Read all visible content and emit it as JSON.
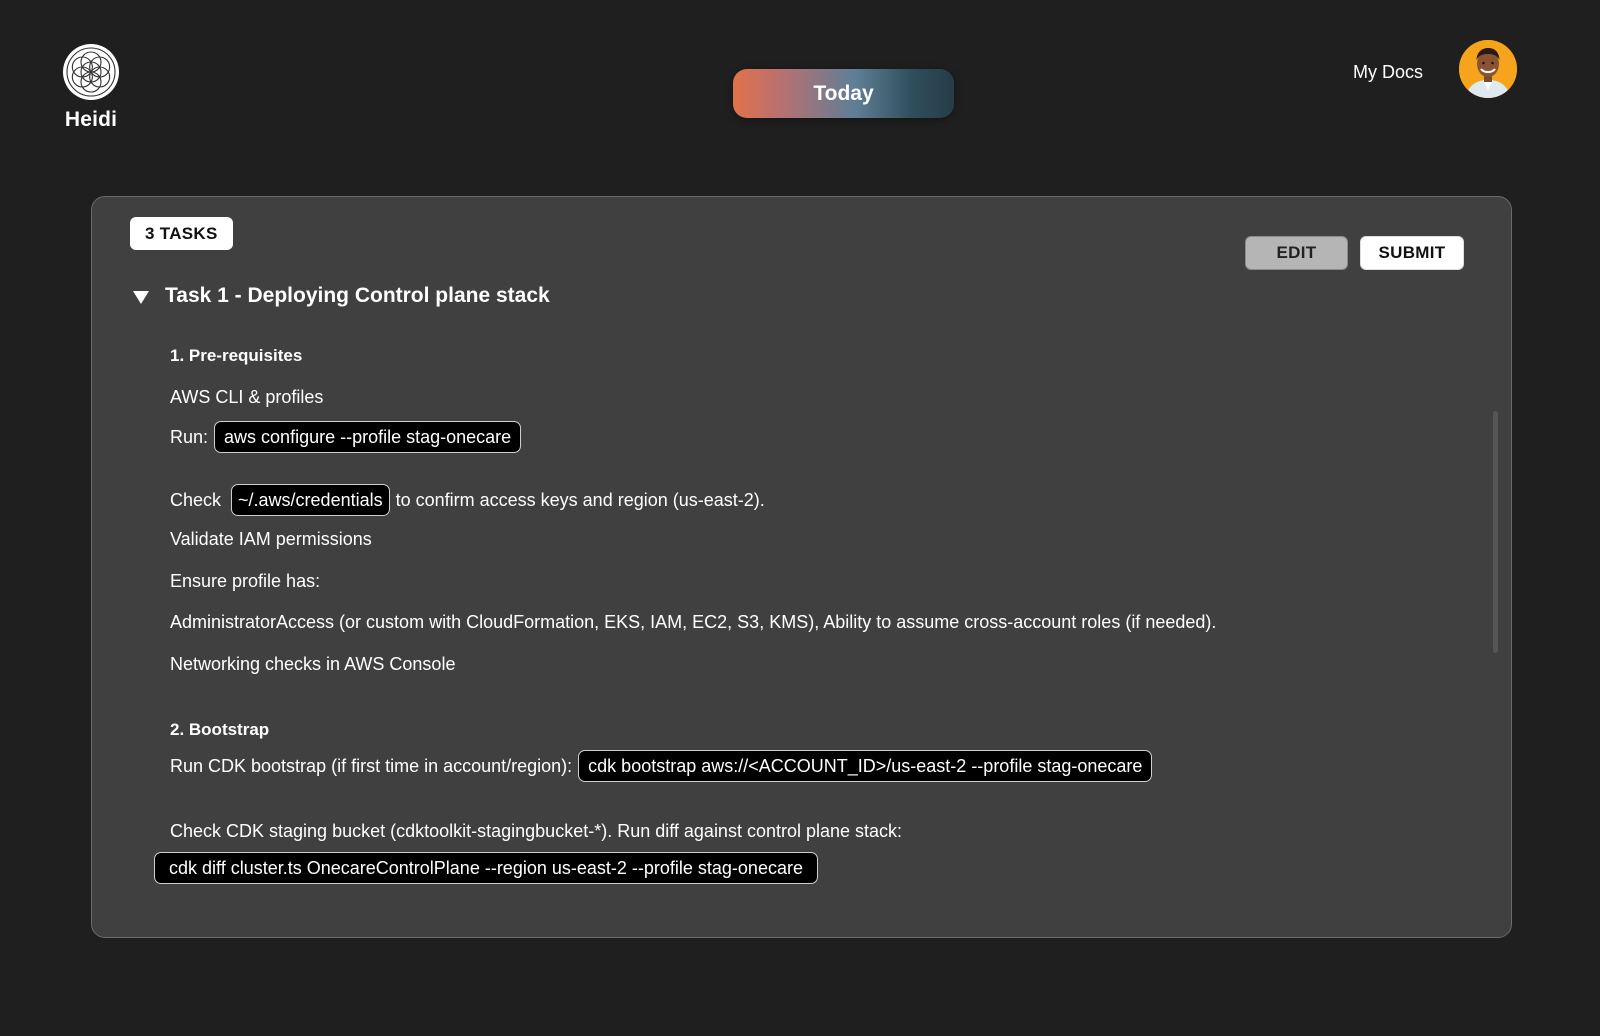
{
  "header": {
    "logo_text": "Heidi",
    "today_label": "Today",
    "my_docs_label": "My Docs"
  },
  "card": {
    "tasks_badge": "3 TASKS",
    "edit_label": "EDIT",
    "submit_label": "SUBMIT",
    "task_title": "Task 1 - Deploying Control plane stack",
    "sections": {
      "prereq": {
        "title": "1. Pre-requisites",
        "aws_cli": "AWS CLI & profiles",
        "run_label": "Run:",
        "run_cmd": "aws configure --profile stag-onecare",
        "check_label": "Check",
        "check_path": "~/.aws/credentials",
        "check_suffix": "to confirm access keys and region (us-east-2).",
        "validate_iam": "Validate IAM permissions",
        "ensure_profile": "Ensure profile has:",
        "admin_access": "AdministratorAccess (or custom with CloudFormation, EKS, IAM, EC2, S3, KMS), Ability to assume cross-account roles (if needed).",
        "networking": "Networking checks in AWS Console"
      },
      "bootstrap": {
        "title": "2. Bootstrap",
        "run_bootstrap_label": "Run CDK bootstrap (if first time in account/region):",
        "run_bootstrap_cmd": "cdk bootstrap aws://<ACCOUNT_ID>/us-east-2 --profile stag-onecare",
        "check_staging": "Check CDK staging bucket (cdktoolkit-stagingbucket-*). Run diff against control plane stack:",
        "diff_cmd": "cdk diff cluster.ts OnecareControlPlane --region us-east-2 --profile stag-onecare"
      }
    }
  },
  "colors": {
    "background": "#1f1f1f",
    "card": "#404040",
    "code_bg": "#000000",
    "avatar_bg": "#f5a41c"
  },
  "icons": {
    "logo": "flower-of-life-logo-icon",
    "collapse": "triangle-down-icon"
  }
}
